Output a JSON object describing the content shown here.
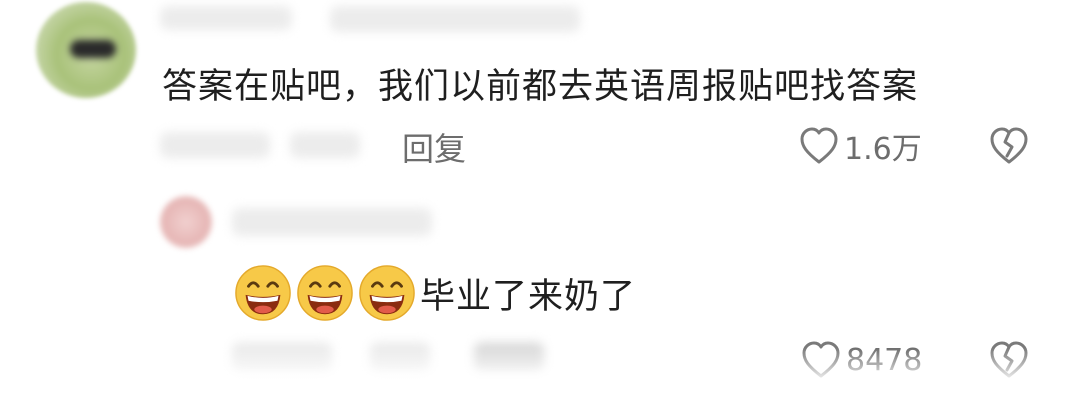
{
  "comments": [
    {
      "text": "答案在贴吧，我们以前都去英语周报贴吧找答案",
      "reply_label": "回复",
      "like_count": "1.6万"
    },
    {
      "text": "毕业了来奶了",
      "emoji": [
        "grinning-face",
        "grinning-face",
        "grinning-face"
      ],
      "like_count": "8478"
    }
  ],
  "colors": {
    "text": "#1f1f1f",
    "meta": "#6d6d6d",
    "icon": "#7a7a7a",
    "emoji_face": "#f7c948"
  }
}
